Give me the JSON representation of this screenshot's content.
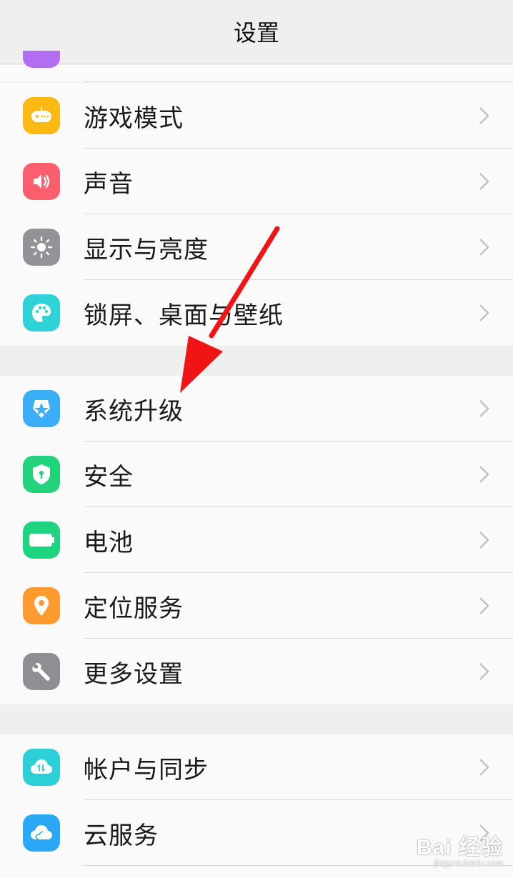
{
  "header": {
    "title": "设置"
  },
  "groups": [
    {
      "items": [
        {
          "label": "游戏模式",
          "icon": "gamepad-icon",
          "color": "#fcb813"
        },
        {
          "label": "声音",
          "icon": "speaker-icon",
          "color": "#fb5f6e"
        },
        {
          "label": "显示与亮度",
          "icon": "sun-icon",
          "color": "#929297"
        },
        {
          "label": "锁屏、桌面与壁纸",
          "icon": "palette-icon",
          "color": "#2ed3d8"
        }
      ]
    },
    {
      "items": [
        {
          "label": "系统升级",
          "icon": "upgrade-icon",
          "color": "#3aaef7"
        },
        {
          "label": "安全",
          "icon": "shield-icon",
          "color": "#23d37c"
        },
        {
          "label": "电池",
          "icon": "battery-icon",
          "color": "#1fd47e"
        },
        {
          "label": "定位服务",
          "icon": "location-pin-icon",
          "color": "#ff9a2e"
        },
        {
          "label": "更多设置",
          "icon": "wrench-icon",
          "color": "#8e8e93"
        }
      ]
    },
    {
      "items": [
        {
          "label": "帐户与同步",
          "icon": "cloud-sync-icon",
          "color": "#2dd0d6"
        },
        {
          "label": "云服务",
          "icon": "cloud-icon",
          "color": "#2aa7f5"
        }
      ]
    }
  ],
  "annotation": {
    "color": "#f01414"
  },
  "watermark": {
    "logo": "Bai 经验",
    "url": "jingyan.baidu.com"
  }
}
